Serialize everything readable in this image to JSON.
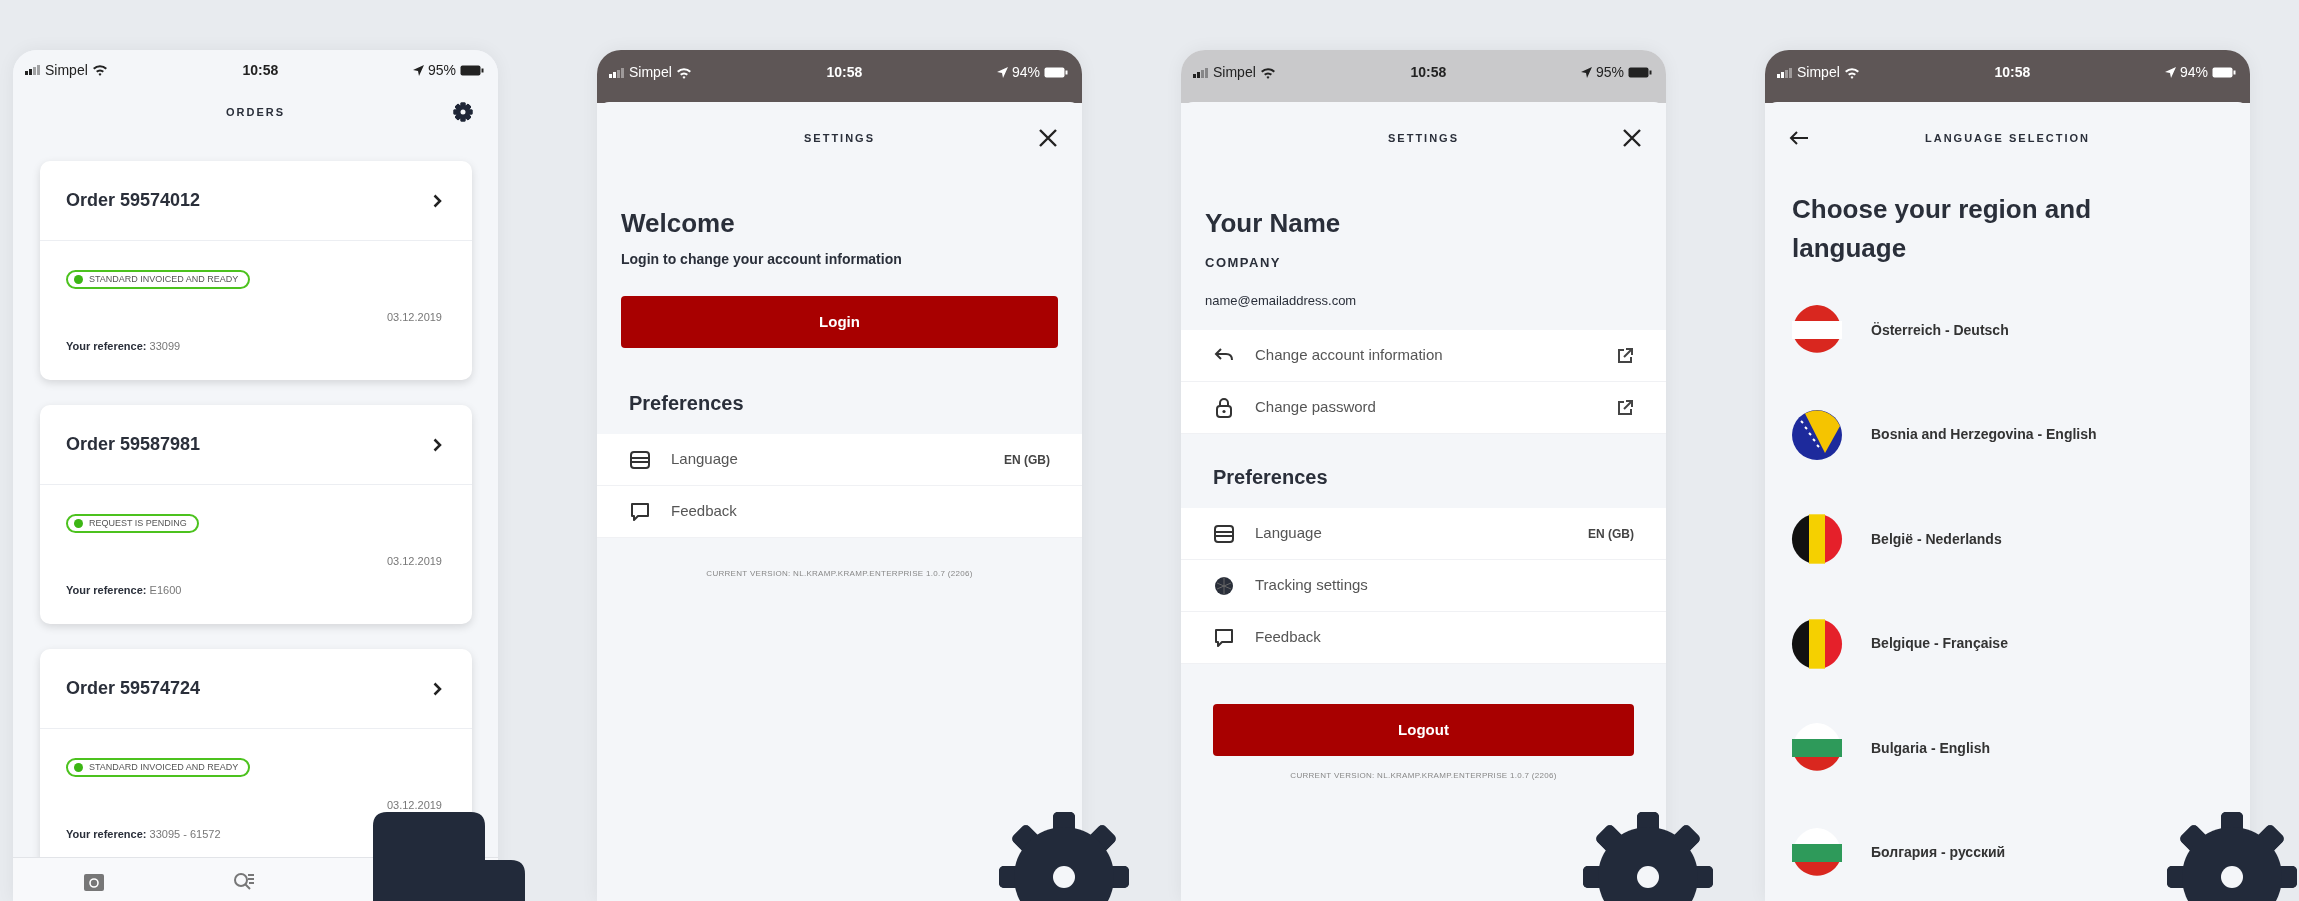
{
  "screens": [
    {
      "kind": "orders",
      "overlay": {
        "kind": "block"
      },
      "status_bar": {
        "kind": "light",
        "carrier": "Simpel",
        "time": "10:58",
        "battery": "95%"
      },
      "title": "ORDERS",
      "orders": [
        {
          "title": "Order 59574012",
          "status": "STANDARD INVOICED AND READY",
          "date": "03.12.2019",
          "reference": "**Your reference:** 33099"
        },
        {
          "title": "Order 59587981",
          "status": "REQUEST IS PENDING",
          "date": "03.12.2019",
          "reference": "**Your reference:** E1600"
        },
        {
          "title": "Order 59574724",
          "status": "STANDARD INVOICED AND READY",
          "date": "03.12.2019",
          "reference": "**Your reference:** 33095 - 61572"
        }
      ],
      "tab_bar": [
        {
          "kind": "camera"
        },
        {
          "kind": "search"
        }
      ]
    },
    {
      "kind": "settings",
      "overlay": {
        "kind": "gear"
      },
      "status_bar": {
        "kind": "dark",
        "carrier": "Simpel",
        "time": "10:58",
        "battery": "94%"
      },
      "title": "SETTINGS",
      "heading": "Welcome",
      "subtitle": "Login to change your account information",
      "login_button": "Login",
      "preferences_title": "Preferences",
      "preferences": [
        {
          "kind": "language",
          "label": "Language",
          "value": "EN (GB)"
        },
        {
          "kind": "feedback",
          "label": "Feedback"
        }
      ],
      "version": "CURRENT VERSION: NL.KRAMP.KRAMP.ENTERPRISE 1.0.7 (2206)"
    },
    {
      "kind": "settings",
      "overlay": {
        "kind": "gear"
      },
      "status_bar": {
        "kind": "grey",
        "carrier": "Simpel",
        "time": "10:58",
        "battery": "95%"
      },
      "title": "SETTINGS",
      "heading": "Your Name",
      "company": "COMPANY",
      "email": "name@emailaddress.com",
      "account_items": [
        {
          "kind": "account",
          "label": "Change account information"
        },
        {
          "kind": "password",
          "label": "Change password"
        }
      ],
      "preferences_title": "Preferences",
      "preferences": [
        {
          "kind": "language",
          "label": "Language",
          "value": "EN (GB)"
        },
        {
          "kind": "tracking",
          "label": "Tracking settings"
        },
        {
          "kind": "feedback",
          "label": "Feedback"
        }
      ],
      "logout_button": "Logout",
      "version": "CURRENT VERSION: NL.KRAMP.KRAMP.ENTERPRISE 1.0.7 (2206)"
    },
    {
      "kind": "language_selection",
      "overlay": {
        "kind": "gear"
      },
      "status_bar": {
        "kind": "dark",
        "carrier": "Simpel",
        "time": "10:58",
        "battery": "94%"
      },
      "title": "LANGUAGE SELECTION",
      "heading": "Choose your region and language",
      "languages": [
        {
          "kind": "at",
          "label": "Österreich - Deutsch"
        },
        {
          "kind": "ba",
          "label": "Bosnia and Herzegovina - English"
        },
        {
          "kind": "be",
          "label": "België - Nederlands"
        },
        {
          "kind": "be",
          "label": "Belgique - Française"
        },
        {
          "kind": "bg",
          "label": "Bulgaria - English"
        },
        {
          "kind": "bg",
          "label": "Болгария - русский"
        }
      ]
    }
  ]
}
